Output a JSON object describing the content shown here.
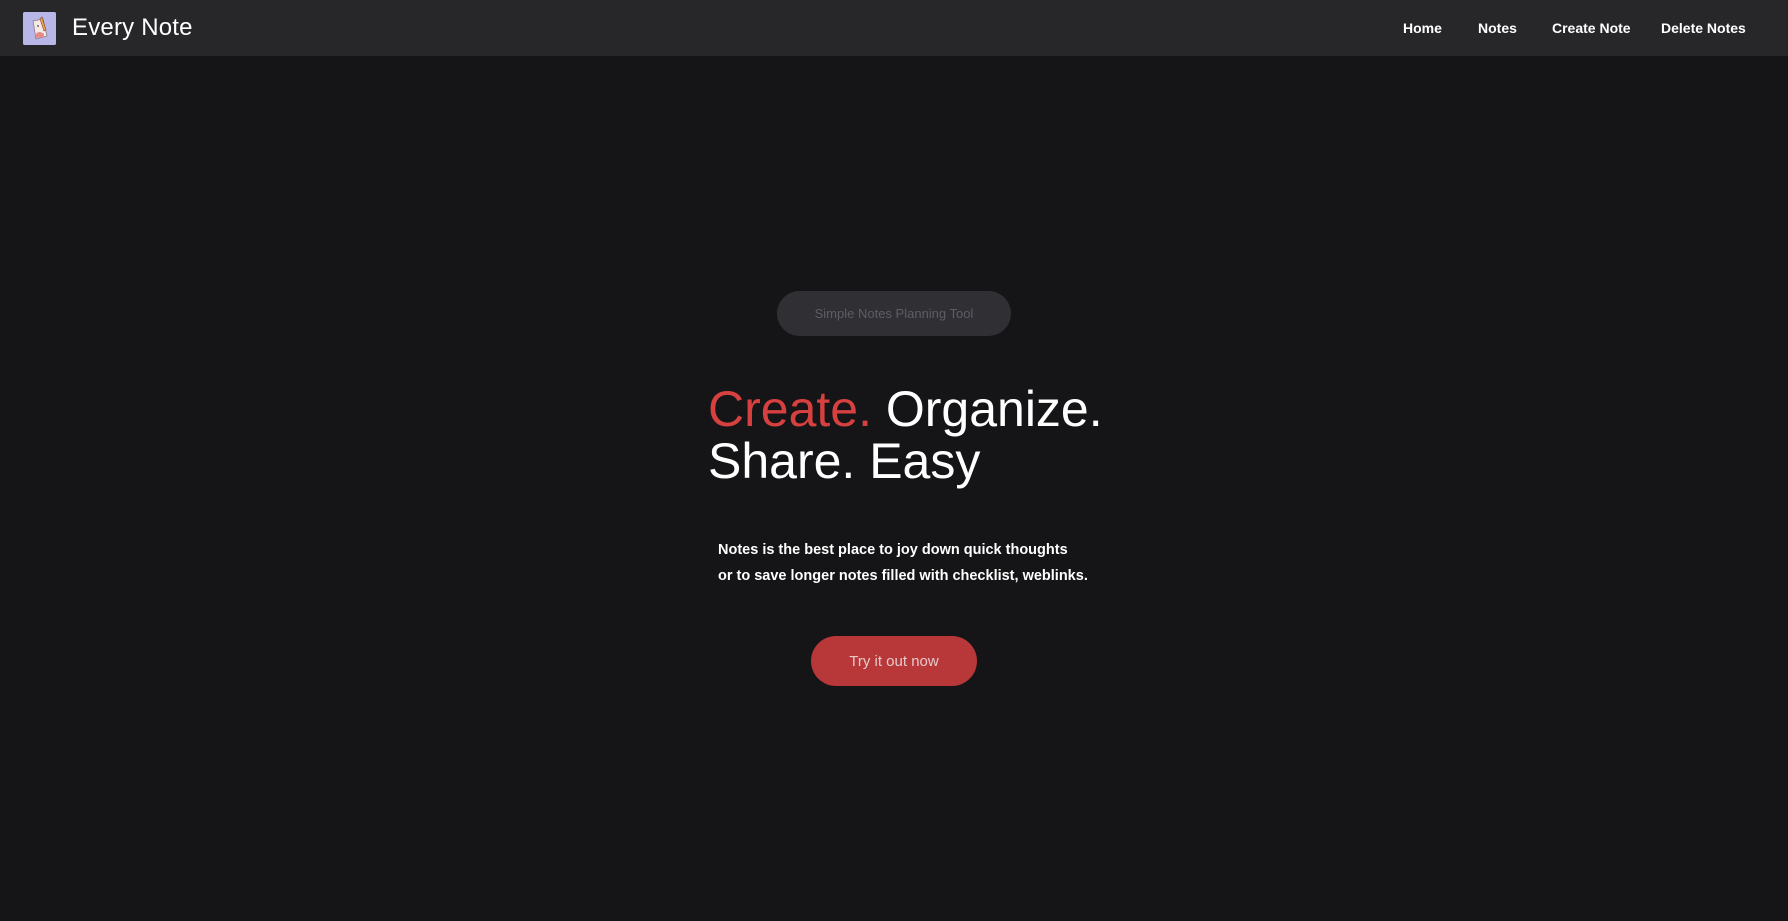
{
  "app": {
    "brand_name": "Every Note",
    "logo_icon": "notebook-pen-icon"
  },
  "nav": {
    "items": [
      {
        "label": "Home"
      },
      {
        "label": "Notes"
      },
      {
        "label": "Create Note"
      },
      {
        "label": "Delete Notes"
      }
    ]
  },
  "hero": {
    "badge": "Simple Notes Planning Tool",
    "headline_accent": "Create.",
    "headline_rest_line1": " Organize.",
    "headline_line2": "Share. Easy",
    "description_line1": "Notes is the best place to joy down quick thoughts",
    "description_line2": "or to save longer notes filled with checklist, weblinks.",
    "cta_label": "Try it out now"
  },
  "colors": {
    "background": "#151517",
    "navbar": "#27272a",
    "accent": "#d6403f",
    "cta": "#b8383a",
    "badge_bg": "#2f2f34",
    "badge_text": "#5d5d66"
  }
}
